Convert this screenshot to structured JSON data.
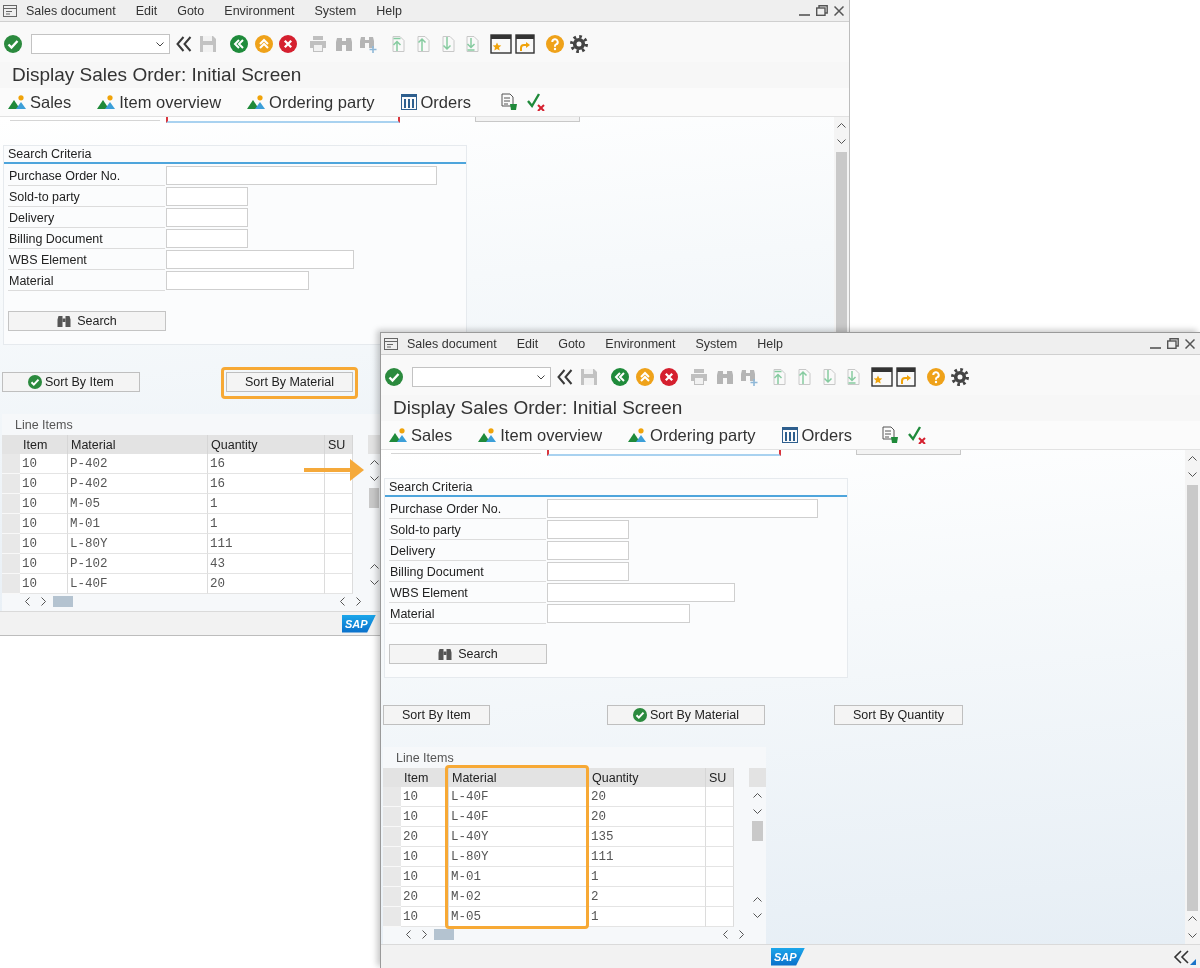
{
  "windows": [
    {
      "menu": [
        "Sales document",
        "Edit",
        "Goto",
        "Environment",
        "System",
        "Help"
      ],
      "title": "Display Sales Order: Initial Screen",
      "app_toolbar": [
        {
          "label": "Sales",
          "kind": "screen"
        },
        {
          "label": "Item overview",
          "kind": "screen"
        },
        {
          "label": "Ordering party",
          "kind": "screen"
        },
        {
          "label": "Orders",
          "kind": "list"
        }
      ],
      "search_criteria": {
        "title": "Search Criteria",
        "fields": [
          {
            "label": "Purchase Order No."
          },
          {
            "label": "Sold-to party"
          },
          {
            "label": "Delivery"
          },
          {
            "label": "Billing Document"
          },
          {
            "label": "WBS Element"
          },
          {
            "label": "Material"
          }
        ],
        "button": "Search"
      },
      "sort_buttons": [
        {
          "label": "Sort By Item",
          "selected": true,
          "highlighted": false
        },
        {
          "label": "Sort By Material",
          "selected": false,
          "highlighted": true
        }
      ],
      "line_items": {
        "title": "Line Items",
        "columns": [
          {
            "label": "Item",
            "highlighted": false
          },
          {
            "label": "Material",
            "highlighted": false
          },
          {
            "label": "Quantity",
            "highlighted": false
          },
          {
            "label": "SU",
            "highlighted": false
          }
        ],
        "rows": [
          [
            "10",
            "P-402",
            "16"
          ],
          [
            "10",
            "P-402",
            "16"
          ],
          [
            "10",
            "M-05",
            "1"
          ],
          [
            "10",
            "M-01",
            "1"
          ],
          [
            "10",
            "L-80Y",
            "111"
          ],
          [
            "10",
            "P-102",
            "43"
          ],
          [
            "10",
            "L-40F",
            "20"
          ]
        ]
      },
      "status_bar": {
        "logo": "SAP"
      }
    },
    {
      "menu": [
        "Sales document",
        "Edit",
        "Goto",
        "Environment",
        "System",
        "Help"
      ],
      "title": "Display Sales Order: Initial Screen",
      "app_toolbar": [
        {
          "label": "Sales",
          "kind": "screen"
        },
        {
          "label": "Item overview",
          "kind": "screen"
        },
        {
          "label": "Ordering party",
          "kind": "screen"
        },
        {
          "label": "Orders",
          "kind": "list"
        }
      ],
      "search_criteria": {
        "title": "Search Criteria",
        "fields": [
          {
            "label": "Purchase Order No."
          },
          {
            "label": "Sold-to party"
          },
          {
            "label": "Delivery"
          },
          {
            "label": "Billing Document"
          },
          {
            "label": "WBS Element"
          },
          {
            "label": "Material"
          }
        ],
        "button": "Search"
      },
      "sort_buttons": [
        {
          "label": "Sort By Item",
          "selected": false,
          "highlighted": false
        },
        {
          "label": "Sort By Material",
          "selected": true,
          "highlighted": false
        },
        {
          "label": "Sort By Quantity",
          "selected": false,
          "highlighted": false
        }
      ],
      "line_items": {
        "title": "Line Items",
        "columns": [
          {
            "label": "Item",
            "highlighted": false
          },
          {
            "label": "Material",
            "highlighted": true
          },
          {
            "label": "Quantity",
            "highlighted": false
          },
          {
            "label": "SU",
            "highlighted": false
          }
        ],
        "rows": [
          [
            "10",
            "L-40F",
            "20"
          ],
          [
            "10",
            "L-40F",
            "20"
          ],
          [
            "20",
            "L-40Y",
            "135"
          ],
          [
            "10",
            "L-80Y",
            "111"
          ],
          [
            "10",
            "M-01",
            "1"
          ],
          [
            "20",
            "M-02",
            "2"
          ],
          [
            "10",
            "M-05",
            "1"
          ]
        ]
      },
      "status_bar": {
        "logo": "SAP"
      }
    }
  ]
}
